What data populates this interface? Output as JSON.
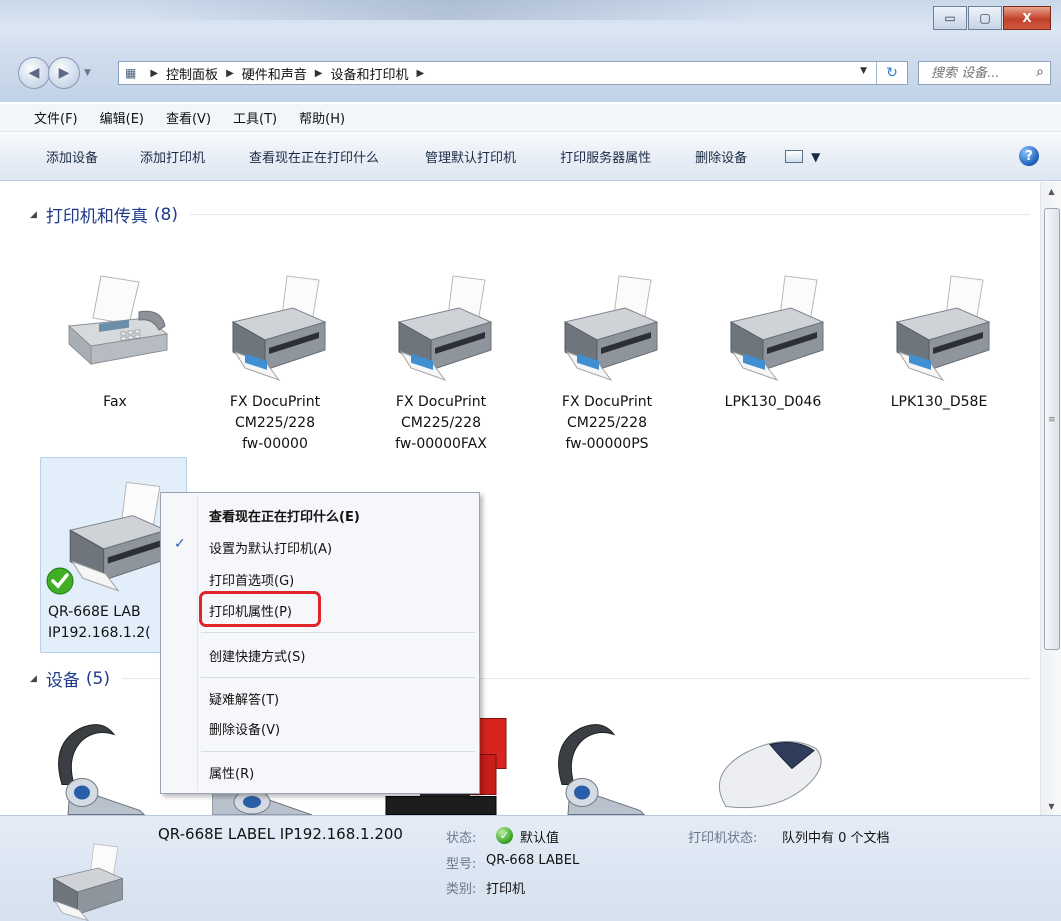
{
  "window": {
    "controls": {
      "minimize": "▭",
      "maximize": "▢",
      "close": "X"
    }
  },
  "address": {
    "breadcrumbs": [
      "控制面板",
      "硬件和声音",
      "设备和打印机"
    ],
    "search_placeholder": "搜索 设备..."
  },
  "menubar": [
    "文件(F)",
    "编辑(E)",
    "查看(V)",
    "工具(T)",
    "帮助(H)"
  ],
  "commands": [
    "添加设备",
    "添加打印机",
    "查看现在正在打印什么",
    "管理默认打印机",
    "打印服务器属性",
    "删除设备"
  ],
  "groups": {
    "printers": {
      "title": "打印机和传真",
      "count": "(8)"
    },
    "devices": {
      "title": "设备",
      "count": "(5)"
    }
  },
  "printers": [
    {
      "label": "Fax",
      "icon": "fax-icon"
    },
    {
      "label": "FX DocuPrint\nCM225/228\nfw-00000",
      "icon": "printer-icon"
    },
    {
      "label": "FX DocuPrint\nCM225/228\nfw-00000FAX",
      "icon": "printer-icon"
    },
    {
      "label": "FX DocuPrint\nCM225/228\nfw-00000PS",
      "icon": "printer-icon"
    },
    {
      "label": "LPK130_D046",
      "icon": "printer-icon"
    },
    {
      "label": "LPK130_D58E",
      "icon": "printer-icon"
    }
  ],
  "selected_printer": {
    "label": "QR-668E LAB\nIP192.168.1.2(",
    "icon": "printer-icon",
    "default_badge": "check-icon"
  },
  "context_menu": {
    "items": [
      {
        "label": "查看现在正在打印什么(E)",
        "bold": true
      },
      {
        "label": "设置为默认打印机(A)",
        "checked": true
      },
      {
        "label": "打印首选项(G)"
      },
      {
        "label": "打印机属性(P)",
        "highlighted": true
      },
      {
        "label": "创建快捷方式(S)"
      },
      {
        "label": "疑难解答(T)"
      },
      {
        "label": "删除设备(V)"
      },
      {
        "label": "属性(R)"
      }
    ],
    "check_mark": "✓",
    "highlight_color": "#e0242a"
  },
  "details": {
    "name": "QR-668E LABEL IP192.168.1.200",
    "status_label": "状态:",
    "status_value": "默认值",
    "model_label": "型号:",
    "model_value": "QR-668 LABEL",
    "category_label": "类别:",
    "category_value": "打印机",
    "printer_status_label": "打印机状态:",
    "printer_status_value": "队列中有 0 个文档"
  },
  "colors": {
    "group_title": "#1e3a8a",
    "selection_bg": "#e3eefb",
    "accent_blue": "#2b5fb5"
  }
}
